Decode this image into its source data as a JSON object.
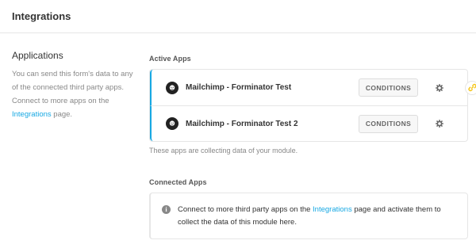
{
  "header": {
    "title": "Integrations"
  },
  "sidebar": {
    "title": "Applications",
    "desc_before": "You can send this form's data to any of the connected third party apps. Connect to more apps on the ",
    "link": "Integrations",
    "desc_after": " page."
  },
  "active": {
    "label": "Active Apps",
    "apps": [
      {
        "name": "Mailchimp - Forminator Test",
        "button": "CONDITIONS",
        "icon": "mailchimp-logo"
      },
      {
        "name": "Mailchimp - Forminator Test 2",
        "button": "CONDITIONS",
        "icon": "mailchimp-logo"
      }
    ],
    "helper": "These apps are collecting data of your module."
  },
  "connected": {
    "label": "Connected Apps",
    "notice_before": "Connect to more third party apps on the ",
    "notice_link": "Integrations",
    "notice_after": " page and activate them to collect the data of this module here."
  },
  "colors": {
    "accent": "#17a8e3",
    "badge": "#f5c518"
  }
}
